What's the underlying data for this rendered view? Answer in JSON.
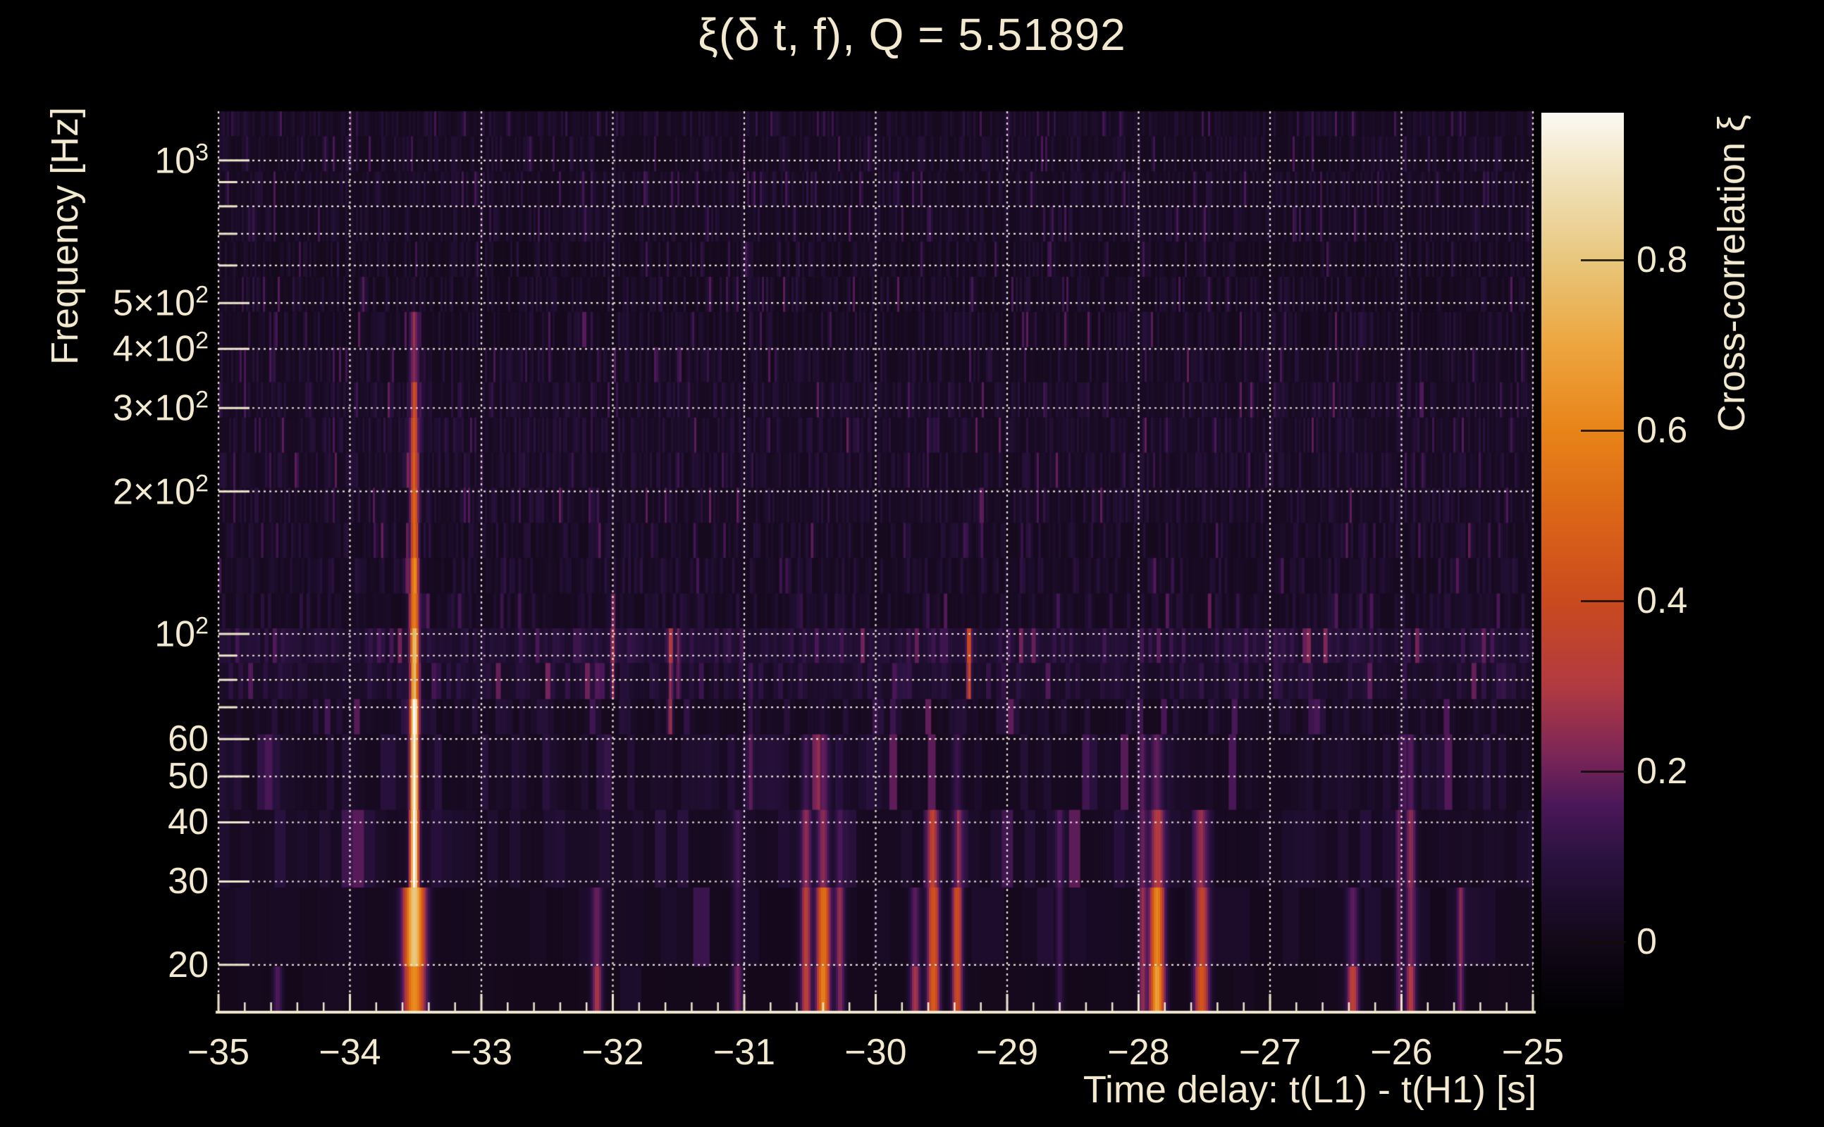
{
  "title": {
    "text": "ξ(δ t, f), Q = 5.51892"
  },
  "x_axis": {
    "title": "Time delay: t(L1) - t(H1) [s]",
    "min": -35,
    "max": -25,
    "minor_tick_step": 0.2,
    "ticks": [
      {
        "t": -35,
        "label": "−35"
      },
      {
        "t": -34,
        "label": "−34"
      },
      {
        "t": -33,
        "label": "−33"
      },
      {
        "t": -32,
        "label": "−32"
      },
      {
        "t": -31,
        "label": "−31"
      },
      {
        "t": -30,
        "label": "−30"
      },
      {
        "t": -29,
        "label": "−29"
      },
      {
        "t": -28,
        "label": "−28"
      },
      {
        "t": -27,
        "label": "−27"
      },
      {
        "t": -26,
        "label": "−26"
      },
      {
        "t": -25,
        "label": "−25"
      }
    ]
  },
  "y_axis": {
    "title": "Frequency [Hz]",
    "scale": "log",
    "min_hz": 16,
    "max_hz": 1270,
    "grid_freqs_hz": [
      20,
      30,
      40,
      50,
      60,
      70,
      80,
      90,
      100,
      200,
      300,
      400,
      500,
      600,
      700,
      800,
      900,
      1000
    ],
    "labeled_ticks": [
      {
        "f": 1000,
        "base": "10",
        "exp": "3"
      },
      {
        "f": 500,
        "base": "5×10",
        "exp": "2"
      },
      {
        "f": 400,
        "base": "4×10",
        "exp": "2"
      },
      {
        "f": 300,
        "base": "3×10",
        "exp": "2"
      },
      {
        "f": 200,
        "base": "2×10",
        "exp": "2"
      },
      {
        "f": 100,
        "base": "10",
        "exp": "2"
      },
      {
        "f": 60,
        "base": "60",
        "exp": ""
      },
      {
        "f": 50,
        "base": "50",
        "exp": ""
      },
      {
        "f": 40,
        "base": "40",
        "exp": ""
      },
      {
        "f": 30,
        "base": "30",
        "exp": ""
      },
      {
        "f": 20,
        "base": "20",
        "exp": ""
      }
    ]
  },
  "colorbar": {
    "title": "Cross-correlation ξ",
    "vmin": -0.08,
    "vmax": 0.97,
    "ticks": [
      {
        "v": 0.8,
        "label": "0.8"
      },
      {
        "v": 0.6,
        "label": "0.6"
      },
      {
        "v": 0.4,
        "label": "0.4"
      },
      {
        "v": 0.2,
        "label": "0.2"
      },
      {
        "v": 0.0,
        "label": "0"
      }
    ],
    "palette_stops": [
      {
        "v": -0.08,
        "c": "#000002"
      },
      {
        "v": 0.0,
        "c": "#130818"
      },
      {
        "v": 0.05,
        "c": "#1d0d2c"
      },
      {
        "v": 0.1,
        "c": "#2b1240"
      },
      {
        "v": 0.16,
        "c": "#4a1758"
      },
      {
        "v": 0.22,
        "c": "#7c2658"
      },
      {
        "v": 0.3,
        "c": "#b13a41"
      },
      {
        "v": 0.4,
        "c": "#ca4a1e"
      },
      {
        "v": 0.5,
        "c": "#db6517"
      },
      {
        "v": 0.6,
        "c": "#e88418"
      },
      {
        "v": 0.7,
        "c": "#eda63f"
      },
      {
        "v": 0.8,
        "c": "#e8c77e"
      },
      {
        "v": 0.9,
        "c": "#f2e4c0"
      },
      {
        "v": 0.97,
        "c": "#fbf9f3"
      }
    ]
  },
  "chart_data": {
    "type": "heatmap",
    "title": "ξ(δ t, f), Q = 5.51892",
    "q_value": 5.51892,
    "xlabel": "Time delay: t(L1) - t(H1) [s]",
    "ylabel": "Frequency [Hz]",
    "zlabel": "Cross-correlation ξ",
    "x_range_s": [
      -35,
      -25
    ],
    "y_range_hz": [
      16,
      1270
    ],
    "y_scale": "log",
    "z_range": [
      -0.08,
      0.97
    ],
    "grid": "dotted",
    "max_correlation": {
      "xi": 0.97,
      "delay_s": -33.51,
      "freq_band_hz": [
        25,
        70
      ]
    },
    "features": [
      {
        "name": "main-streak",
        "delay_s": -33.51,
        "sigma_s": 0.022,
        "sigma_low_s": 0.055,
        "profile": [
          [
            16,
            20,
            0.6
          ],
          [
            20,
            27,
            0.8
          ],
          [
            27,
            72,
            0.97
          ],
          [
            72,
            108,
            0.7
          ],
          [
            108,
            150,
            0.58
          ],
          [
            150,
            220,
            0.48
          ],
          [
            220,
            300,
            0.4
          ],
          [
            300,
            360,
            0.3
          ],
          [
            360,
            480,
            0.22
          ]
        ]
      },
      {
        "name": "blob",
        "delay_s": -30.4,
        "sigma_s": 0.035,
        "profile": [
          [
            16,
            20,
            0.58
          ],
          [
            20,
            26,
            0.52
          ],
          [
            26,
            34,
            0.36
          ],
          [
            34,
            46,
            0.22
          ],
          [
            46,
            62,
            0.13
          ]
        ]
      },
      {
        "name": "blob",
        "delay_s": -30.53,
        "sigma_s": 0.028,
        "profile": [
          [
            16,
            26,
            0.32
          ],
          [
            26,
            36,
            0.2
          ],
          [
            36,
            52,
            0.12
          ]
        ]
      },
      {
        "name": "blob",
        "delay_s": -30.27,
        "sigma_s": 0.025,
        "profile": [
          [
            16,
            30,
            0.22
          ],
          [
            30,
            46,
            0.13
          ]
        ]
      },
      {
        "name": "blob",
        "delay_s": -29.56,
        "sigma_s": 0.033,
        "profile": [
          [
            16,
            20,
            0.46
          ],
          [
            20,
            28,
            0.42
          ],
          [
            28,
            36,
            0.28
          ],
          [
            36,
            50,
            0.16
          ]
        ]
      },
      {
        "name": "blob",
        "delay_s": -29.38,
        "sigma_s": 0.028,
        "profile": [
          [
            16,
            26,
            0.4
          ],
          [
            26,
            34,
            0.28
          ],
          [
            34,
            46,
            0.17
          ],
          [
            46,
            64,
            0.11
          ]
        ]
      },
      {
        "name": "thin-line",
        "delay_s": -29.29,
        "sigma_s": 0.012,
        "profile": [
          [
            68,
            108,
            0.36
          ]
        ]
      },
      {
        "name": "blob",
        "delay_s": -29.7,
        "sigma_s": 0.028,
        "profile": [
          [
            16,
            24,
            0.28
          ],
          [
            24,
            34,
            0.17
          ]
        ]
      },
      {
        "name": "blob",
        "delay_s": -27.86,
        "sigma_s": 0.038,
        "profile": [
          [
            16,
            20,
            0.66
          ],
          [
            20,
            28,
            0.6
          ],
          [
            28,
            34,
            0.38
          ],
          [
            34,
            46,
            0.26
          ],
          [
            46,
            60,
            0.15
          ]
        ]
      },
      {
        "name": "blob",
        "delay_s": -27.52,
        "sigma_s": 0.038,
        "profile": [
          [
            16,
            22,
            0.42
          ],
          [
            22,
            30,
            0.32
          ],
          [
            30,
            42,
            0.17
          ]
        ]
      },
      {
        "name": "blob",
        "delay_s": -27.97,
        "sigma_s": 0.022,
        "profile": [
          [
            16,
            30,
            0.24
          ],
          [
            30,
            58,
            0.14
          ]
        ]
      },
      {
        "name": "blob",
        "delay_s": -26.37,
        "sigma_s": 0.032,
        "profile": [
          [
            16,
            20,
            0.32
          ],
          [
            20,
            30,
            0.17
          ]
        ]
      },
      {
        "name": "blob",
        "delay_s": -25.93,
        "sigma_s": 0.028,
        "profile": [
          [
            16,
            22,
            0.3
          ],
          [
            22,
            44,
            0.21
          ],
          [
            44,
            62,
            0.12
          ]
        ]
      },
      {
        "name": "blob",
        "delay_s": -32.12,
        "sigma_s": 0.028,
        "profile": [
          [
            16,
            22,
            0.28
          ],
          [
            22,
            30,
            0.16
          ]
        ]
      },
      {
        "name": "thin-line",
        "delay_s": -31.56,
        "sigma_s": 0.013,
        "profile": [
          [
            58,
            100,
            0.2
          ]
        ]
      },
      {
        "name": "thin-line",
        "delay_s": -31.5,
        "sigma_s": 0.011,
        "profile": [
          [
            70,
            110,
            0.16
          ]
        ]
      },
      {
        "name": "thin-line",
        "delay_s": -32.0,
        "sigma_s": 0.011,
        "profile": [
          [
            78,
            115,
            0.22
          ]
        ]
      },
      {
        "name": "blob",
        "delay_s": -26.02,
        "sigma_s": 0.018,
        "profile": [
          [
            16,
            48,
            0.18
          ]
        ]
      },
      {
        "name": "blob",
        "delay_s": -25.55,
        "sigma_s": 0.018,
        "profile": [
          [
            16,
            30,
            0.2
          ]
        ]
      },
      {
        "name": "blob",
        "delay_s": -34.55,
        "sigma_s": 0.025,
        "profile": [
          [
            16,
            22,
            0.16
          ]
        ]
      },
      {
        "name": "blob",
        "delay_s": -31.05,
        "sigma_s": 0.028,
        "profile": [
          [
            16,
            24,
            0.2
          ],
          [
            24,
            40,
            0.12
          ]
        ]
      },
      {
        "name": "blob",
        "delay_s": -28.6,
        "sigma_s": 0.02,
        "profile": [
          [
            16,
            40,
            0.12
          ]
        ]
      },
      {
        "name": "thin-line",
        "delay_s": -30.95,
        "sigma_s": 0.012,
        "profile": [
          [
            50,
            80,
            0.12
          ]
        ]
      }
    ]
  },
  "render": {
    "seed": 77,
    "row_boundaries_hz": [
      16,
      19.9,
      29.2,
      42.6,
      61.5,
      73,
      87,
      103,
      122,
      145,
      172,
      204,
      242,
      287,
      341,
      404,
      480,
      569,
      675,
      801,
      950,
      1127,
      1270
    ],
    "col_width": {
      "k": 560,
      "min": 3,
      "max": 30
    },
    "noise": {
      "base": 0.015,
      "amp": 0.085,
      "exponent": 2.4,
      "spike_u": 0.95,
      "spike_gain": 2.0
    },
    "row_gain": [
      {
        "below_hz": 19.5,
        "gain": 0.35
      },
      {
        "below_hz": 30,
        "gain": 0.75
      },
      {
        "above_hz": 550,
        "gain": 0.85
      }
    ],
    "bright_rows": [
      {
        "f_lo": 87,
        "f_hi": 103,
        "boost": 0.05
      },
      {
        "f_lo": 73,
        "f_hi": 87,
        "boost": 0.025
      }
    ],
    "grid_color": "rgba(246,240,222,0.95)",
    "axis_color": "#efe7cc",
    "text_color": "#f2e9cf"
  }
}
